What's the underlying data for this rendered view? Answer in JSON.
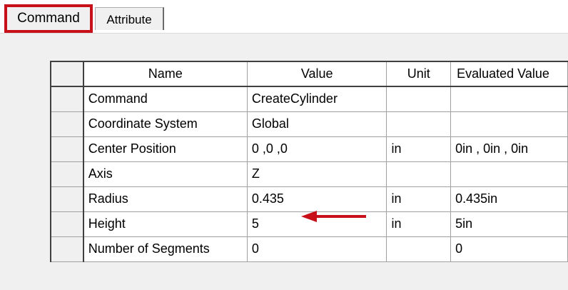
{
  "tabs": {
    "command": "Command",
    "attribute": "Attribute"
  },
  "grid": {
    "columns": [
      "Name",
      "Value",
      "Unit",
      "Evaluated Value"
    ],
    "rows": [
      {
        "name": "Command",
        "value": "CreateCylinder",
        "unit": "",
        "evaluated": ""
      },
      {
        "name": "Coordinate System",
        "value": "Global",
        "unit": "",
        "evaluated": ""
      },
      {
        "name": "Center Position",
        "value": "0 ,0 ,0",
        "unit": "in",
        "evaluated": "0in , 0in , 0in"
      },
      {
        "name": "Axis",
        "value": "Z",
        "unit": "",
        "evaluated": ""
      },
      {
        "name": "Radius",
        "value": "0.435",
        "unit": "in",
        "evaluated": "0.435in"
      },
      {
        "name": "Height",
        "value": "5",
        "unit": "in",
        "evaluated": "5in"
      },
      {
        "name": "Number of Segments",
        "value": "0",
        "unit": "",
        "evaluated": "0"
      }
    ]
  },
  "annotation": {
    "arrow_icon": "left-arrow-icon",
    "highlight_color": "#c8101a"
  }
}
